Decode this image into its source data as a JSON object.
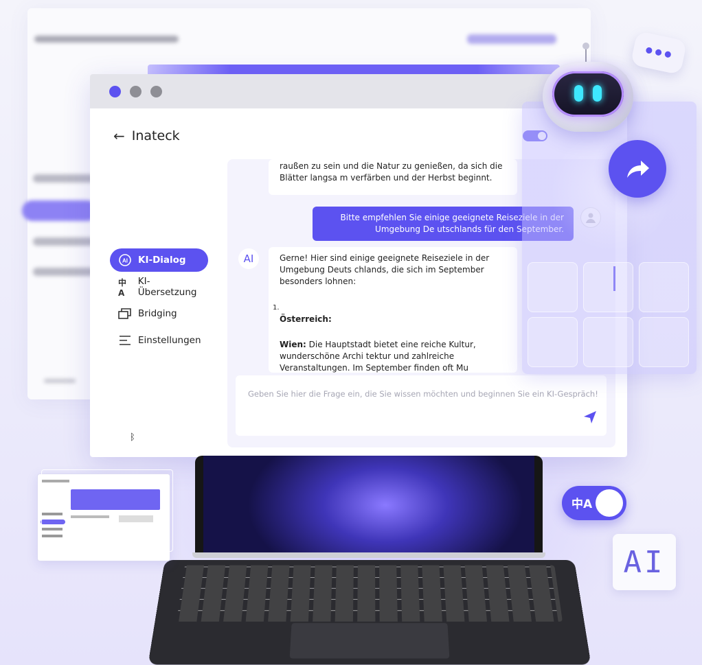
{
  "window": {
    "title": "Inateck",
    "traffic_colors": [
      "#5c52f0",
      "#8e8e95",
      "#8e8e95"
    ]
  },
  "sidebar": {
    "items": [
      {
        "label": "KI-Dialog",
        "icon": "ai-icon",
        "active": true
      },
      {
        "label": "KI-Übersetzung",
        "icon": "translate-icon",
        "active": false
      },
      {
        "label": "Bridging",
        "icon": "bridging-icon",
        "active": false
      },
      {
        "label": "Einstellungen",
        "icon": "settings-icon",
        "active": false
      }
    ],
    "bluetooth_icon": "bluetooth-icon"
  },
  "chat": {
    "messages": [
      {
        "role": "bot",
        "text": "raußen zu sein und die Natur zu genießen, da sich die Blätter langsa m verfärben und der Herbst beginnt."
      },
      {
        "role": "user",
        "text": "Bitte empfehlen Sie einige geeignete Reiseziele in der Umgebung De utschlands für den September."
      },
      {
        "role": "bot",
        "avatar": "AI",
        "intro": "Gerne! Hier sind einige geeignete Reiseziele in der Umgebung Deuts chlands, die sich im September besonders lohnen:",
        "list_number": "1.",
        "list_title": "Österreich:",
        "detail_bold": "Wien:",
        "detail_text": " Die Hauptstadt bietet eine reiche Kultur, wunderschöne Archi tektur und zahlreiche Veranstaltungen. Im September finden oft Mu sikfestivals und kulturelle Events statt."
      }
    ],
    "input_placeholder": "Geben Sie hier die Frage ein, die Sie wissen möchten und beginnen Sie ein KI-Gespräch!",
    "send_icon": "send-icon"
  },
  "decor": {
    "ai_tile_text": "AI",
    "translate_icon_text": "中A",
    "accent": "#5c52f0"
  }
}
